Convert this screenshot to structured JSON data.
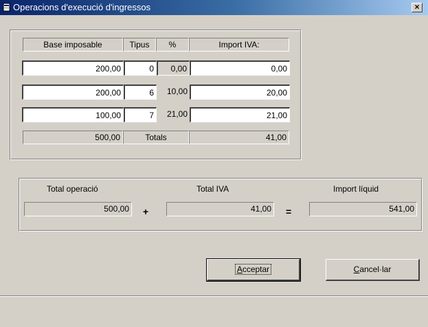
{
  "window": {
    "title": "Operacions d'execució d'ingressos",
    "close_glyph": "×"
  },
  "table": {
    "headers": {
      "base": "Base imposable",
      "tipus": "Tipus",
      "pct": "%",
      "import": "Import IVA:"
    },
    "rows": [
      {
        "base": "200,00",
        "tipus": "0",
        "pct": "0,00",
        "import": "0,00"
      },
      {
        "base": "200,00",
        "tipus": "6",
        "pct": "10,00",
        "import": "20,00"
      },
      {
        "base": "100,00",
        "tipus": "7",
        "pct": "21,00",
        "import": "21,00"
      }
    ],
    "totals": {
      "base": "500,00",
      "label": "Totals",
      "import": "41,00"
    }
  },
  "summary": {
    "total_operacio_label": "Total operació",
    "total_iva_label": "Total IVA",
    "import_liquid_label": "Import líquid",
    "total_operacio": "500,00",
    "total_iva": "41,00",
    "import_liquid": "541,00",
    "plus": "+",
    "equals": "="
  },
  "buttons": {
    "accept": {
      "hotkey": "A",
      "rest": "cceptar"
    },
    "cancel": {
      "hotkey": "C",
      "rest": "ancel·lar"
    }
  },
  "colors": {
    "face": "#d4d0c8",
    "title_start": "#0a246a",
    "title_end": "#a6caf0"
  },
  "icons": {
    "title": "window-app-icon",
    "close": "close-icon"
  }
}
